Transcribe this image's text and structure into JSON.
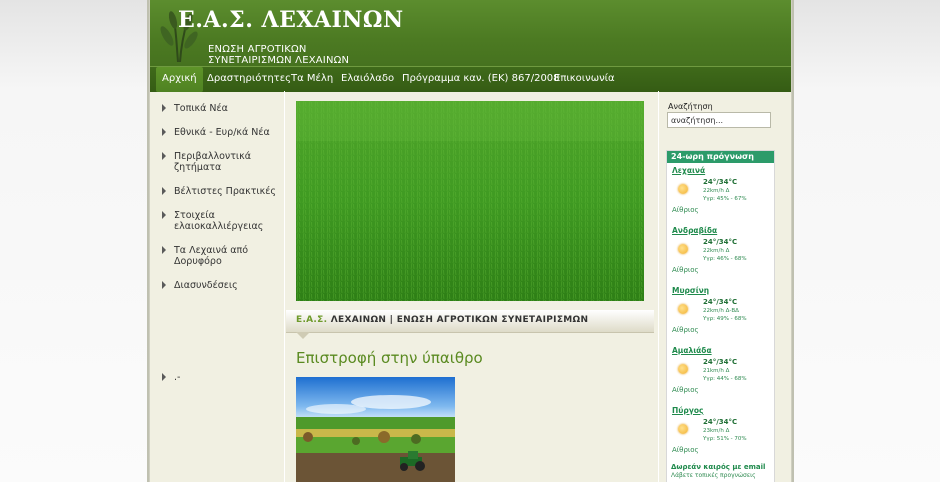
{
  "header": {
    "title": "Ε.Α.Σ. ΛΕΧΑΙΝΩΝ",
    "subtitle_line1": "ΕΝΩΣΗ ΑΓΡΟΤΙΚΩΝ",
    "subtitle_line2": "ΣΥΝΕΤΑΙΡΙΣΜΩΝ ΛΕΧΑΙΝΩΝ"
  },
  "nav": {
    "items": [
      {
        "label": "Αρχική",
        "active": true
      },
      {
        "label": "Δραστηριότητες"
      },
      {
        "label": "Τα Μέλη"
      },
      {
        "label": "Ελαιόλαδο"
      },
      {
        "label": "Πρόγραμμα καν. (ΕΚ) 867/2008"
      },
      {
        "label": "Επικοινωνία"
      }
    ]
  },
  "sidebar": {
    "items": [
      {
        "label": "Τοπικά Νέα"
      },
      {
        "label": "Εθνικά - Ευρ/κά Νέα"
      },
      {
        "label": "Περιβαλλοντικά ζητήματα"
      },
      {
        "label": "Βέλτιστες Πρακτικές"
      },
      {
        "label": "Στοιχεία ελαιοκαλλιέργειας"
      },
      {
        "label": "Τα Λεχαινά από Δορυφόρο"
      },
      {
        "label": "Διασυνδέσεις"
      }
    ],
    "extra_item": ".-"
  },
  "ribbon": {
    "green_part": "Ε.Α.Σ.",
    "dark_part": "ΛΕΧΑΙΝΩΝ | ΕΝΩΣΗ ΑΓΡΟΤΙΚΩΝ ΣΥΝΕΤΑΙΡΙΣΜΩΝ"
  },
  "article": {
    "title": "Επιστροφή στην ύπαιθρο"
  },
  "search": {
    "label": "Αναζήτηση",
    "value": "αναζήτηση..."
  },
  "weather": {
    "title": "24-ωρη πρόγνωση",
    "cities": [
      {
        "name": "Λεχαινά",
        "temp": "24°/34°C",
        "wind": "22km/h Δ",
        "humidity": "Υγρ: 45% - 67%",
        "condition": "Αίθριος"
      },
      {
        "name": "Ανδραβίδα",
        "temp": "24°/34°C",
        "wind": "22km/h Δ",
        "humidity": "Υγρ: 46% - 68%",
        "condition": "Αίθριος"
      },
      {
        "name": "Μυρσίνη",
        "temp": "24°/34°C",
        "wind": "22km/h Δ-ΒΔ",
        "humidity": "Υγρ: 49% - 68%",
        "condition": "Αίθριος"
      },
      {
        "name": "Αμαλιάδα",
        "temp": "24°/34°C",
        "wind": "21km/h Δ",
        "humidity": "Υγρ: 44% - 68%",
        "condition": "Αίθριος"
      },
      {
        "name": "Πύργος",
        "temp": "24°/34°C",
        "wind": "23km/h Δ",
        "humidity": "Υγρ: 51% - 70%",
        "condition": "Αίθριος"
      }
    ],
    "promo_title": "Δωρεάν καιρός με email",
    "promo_text": "Λάβετε τοπικές προγνώσεις"
  },
  "colors": {
    "header_green": "#4c7a22",
    "nav_green": "#3f6a1a",
    "active_nav": "#5e9429",
    "title_green": "#5a8a20",
    "weather_teal": "#2c9b6a",
    "content_bg": "#f1f0e2"
  }
}
